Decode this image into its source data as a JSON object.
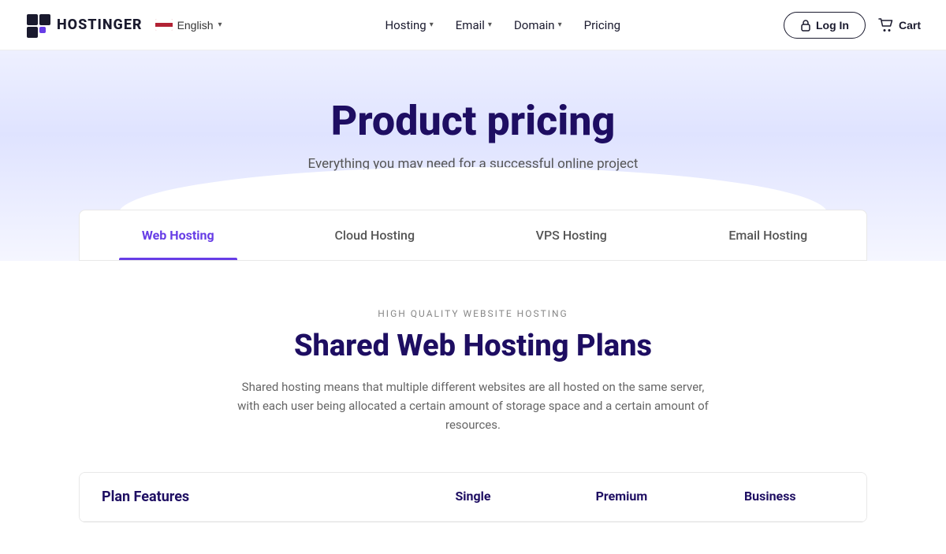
{
  "brand": {
    "name": "HOSTINGER",
    "logo_alt": "Hostinger logo"
  },
  "nav": {
    "language": "English",
    "links": [
      {
        "label": "Hosting",
        "has_dropdown": true
      },
      {
        "label": "Email",
        "has_dropdown": true
      },
      {
        "label": "Domain",
        "has_dropdown": true
      },
      {
        "label": "Pricing",
        "has_dropdown": false
      }
    ],
    "login_label": "Log In",
    "cart_label": "Cart"
  },
  "hero": {
    "title": "Product pricing",
    "subtitle": "Everything you may need for a successful online project"
  },
  "tabs": [
    {
      "id": "web",
      "label": "Web Hosting",
      "active": true
    },
    {
      "id": "cloud",
      "label": "Cloud Hosting",
      "active": false
    },
    {
      "id": "vps",
      "label": "VPS Hosting",
      "active": false
    },
    {
      "id": "email",
      "label": "Email Hosting",
      "active": false
    }
  ],
  "section": {
    "tag": "HIGH QUALITY WEBSITE HOSTING",
    "title": "Shared Web Hosting Plans",
    "description": "Shared hosting means that multiple different websites are all hosted on the same server, with each user being allocated a certain amount of storage space and a certain amount of resources."
  },
  "plans": {
    "features_label": "Plan Features",
    "columns": [
      {
        "name": "Single"
      },
      {
        "name": "Premium"
      },
      {
        "name": "Business"
      }
    ]
  }
}
